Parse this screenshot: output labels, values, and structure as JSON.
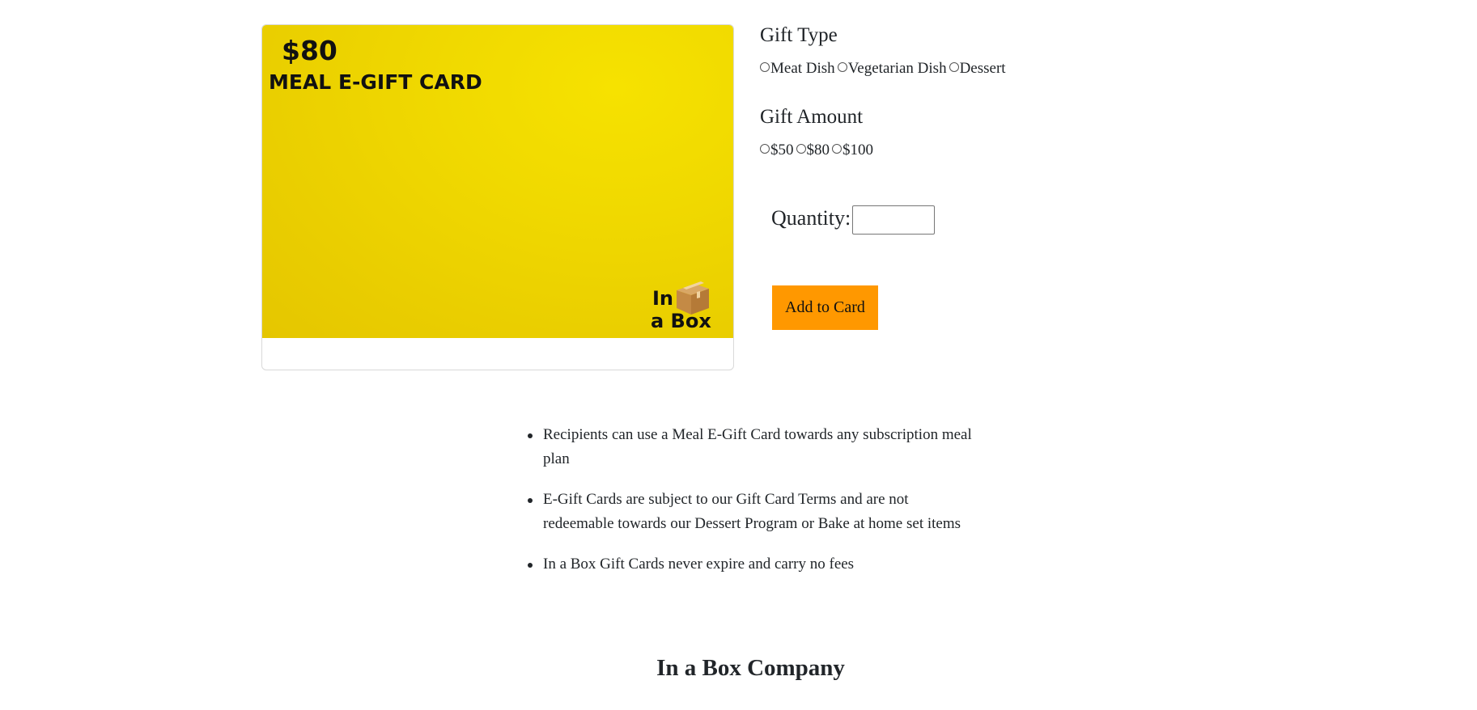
{
  "card": {
    "price": "$80",
    "title": "MEAL E-GIFT CARD",
    "logo_line1": "In",
    "logo_line2": "a Box",
    "logo_icon": "cardboard-box-icon",
    "background_color": "#f0d900"
  },
  "gift_type": {
    "heading": "Gift Type",
    "options": [
      "Meat Dish",
      "Vegetarian Dish",
      "Dessert"
    ]
  },
  "gift_amount": {
    "heading": "Gift Amount",
    "options": [
      "$50",
      "$80",
      "$100"
    ]
  },
  "quantity": {
    "label": "Quantity:",
    "value": ""
  },
  "add_button": {
    "label": "Add to Card",
    "color": "#ff9800"
  },
  "bullets": [
    "Recipients can use a Meal E-Gift Card towards any subscription meal plan",
    "E-Gift Cards are subject to our Gift Card Terms and are not redeemable towards our Dessert Program or Bake at home set items",
    "In a Box Gift Cards never expire and carry no fees"
  ],
  "footer": {
    "title": "In a Box Company"
  }
}
